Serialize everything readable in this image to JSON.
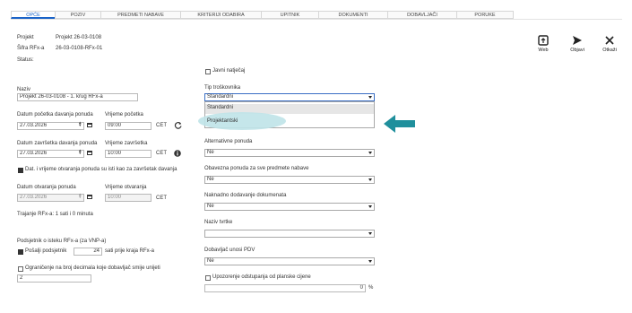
{
  "tabs": [
    {
      "label": "OPĆE"
    },
    {
      "label": "POZIV"
    },
    {
      "label": "PREDMETI NABAVE"
    },
    {
      "label": "KRITERIJI ODABIRA"
    },
    {
      "label": "UPITNIK"
    },
    {
      "label": "DOKUMENTI"
    },
    {
      "label": "DOBAVLJAČI"
    },
    {
      "label": "PORUKE"
    }
  ],
  "toolbar": {
    "web": "Web",
    "objavi": "Objavi",
    "otkazi": "Otkaži"
  },
  "header": {
    "project_label": "Projekt",
    "project_value": "Projekt 26-03-0108",
    "rfx_label": "Šifra RFx-a",
    "rfx_value": "26-03-0108-RFx-01",
    "status_label": "Status:"
  },
  "left": {
    "naziv_label": "Naziv",
    "naziv_value": "Projekt 26-03-0108 - 1. krug RFx-a",
    "start_date_label": "Datum početka davanja ponuda",
    "start_time_label": "Vrijeme početka",
    "start_date": "27.03.2026",
    "start_time": "09:00",
    "tz1": "CET",
    "end_date_label": "Datum završetka davanja ponuda",
    "end_time_label": "Vrijeme završetka",
    "end_date": "27.03.2026",
    "end_time": "10:00",
    "tz2": "CET",
    "same_as_end": "Dat. i vrijeme otvaranja ponuda su isti kao za završetak davanja",
    "open_date_label": "Datum otvaranja ponuda",
    "open_time_label": "Vrijeme otvaranja",
    "open_date": "27.03.2026",
    "open_time": "10:00",
    "tz3": "CET",
    "duration": "Trajanje RFx-a: 1 sati i 0 minuta",
    "reminder_label": "Podsjetnik o isteku RFx-a (za VNP-a)",
    "reminder_chk": "Pošalji podsjetnik",
    "reminder_value": "24",
    "reminder_suffix": "sati prije kraja RFx-a",
    "decimals_label": "Ograničenje na broj decimala koje dobavljač smije unijeti",
    "decimals_value": "2"
  },
  "right": {
    "javni": "Javni natječaj",
    "tip_label": "Tip troškovnika",
    "tip_value": "Standardni",
    "tip_options": [
      "Standardni",
      "Projektantski"
    ],
    "alt_label": "Alternativne ponuda",
    "alt_value": "Ne",
    "obv_label": "Obavezna ponuda za sve predmete nabave",
    "obv_value": "Ne",
    "nak_label": "Naknadno dodavanje dokumenata",
    "nak_value": "Ne",
    "naziv_tvrtke_label": "Naziv tvrtke",
    "naziv_tvrtke_value": "",
    "pdv_label": "Dobavljač unosi PDV",
    "pdv_value": "Ne",
    "upoz_label": "Upozorenje odstupanja od planske cijene",
    "upoz_value": "0",
    "upoz_unit": "%"
  },
  "colors": {
    "accent": "#1a63c8",
    "arrow": "#1f8f9c",
    "highlight": "#bfe3e8"
  }
}
